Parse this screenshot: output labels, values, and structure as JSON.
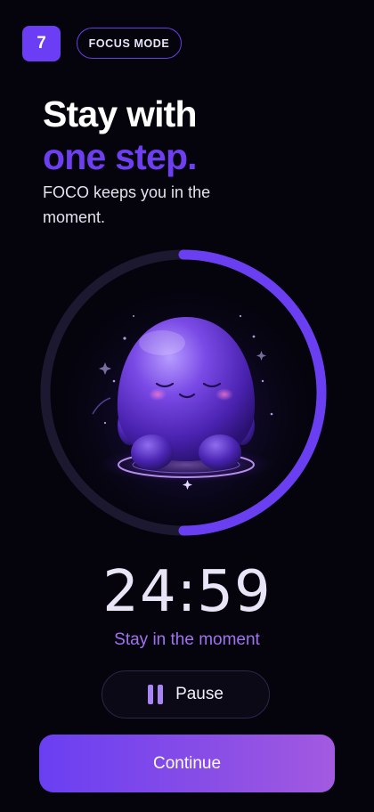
{
  "header": {
    "step_number": "7",
    "mode_label": "FOCUS MODE"
  },
  "hero": {
    "headline_line1": "Stay with",
    "headline_line2": "one step.",
    "subtitle": "FOCO keeps you in the moment."
  },
  "timer": {
    "progress_fraction": 0.5,
    "time_remaining": "24:59",
    "caption": "Stay in the moment"
  },
  "actions": {
    "pause_label": "Pause",
    "continue_label": "Continue"
  },
  "colors": {
    "accent": "#6d3ff0",
    "background": "#05040d",
    "caption": "#a172f0"
  },
  "icons": {
    "pause": "pause-icon",
    "mascot": "blob-mascot-illustration"
  }
}
